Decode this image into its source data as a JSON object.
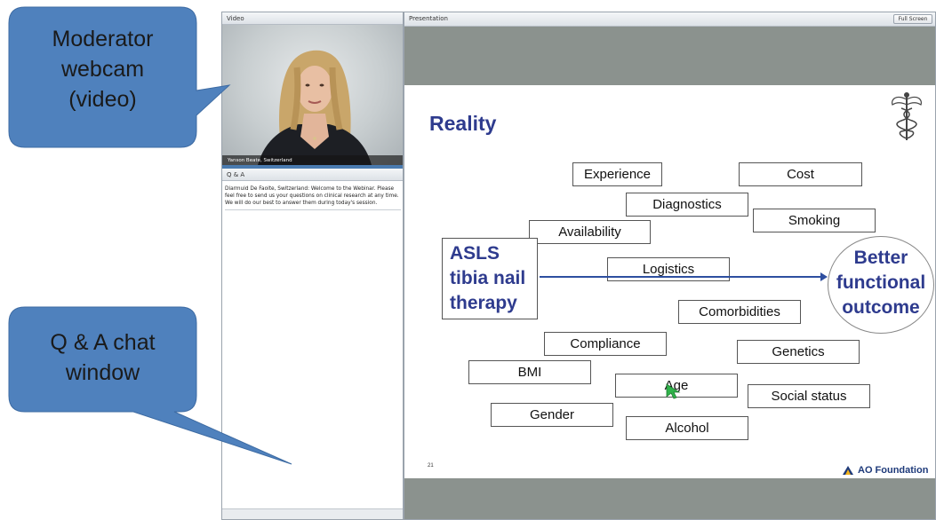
{
  "video_panel": {
    "header": "Video",
    "caption": "Yanson Beate, Switzerland"
  },
  "qa_panel": {
    "header": "Q & A",
    "message": "Diarmuid De Faoite, Switzerland: Welcome to the Webinar. Please feel free to send us your questions on clinical research at any time. We will do our best to answer them during today's session."
  },
  "presentation": {
    "header": "Presentation",
    "fullscreen_label": "Full Screen",
    "slide": {
      "title": "Reality",
      "number": "21",
      "logo_text": "AO Foundation",
      "left_term": [
        "ASLS",
        "tibia nail",
        "therapy"
      ],
      "right_term": [
        "Better",
        "functional",
        "outcome"
      ],
      "factors": {
        "experience": "Experience",
        "cost": "Cost",
        "diagnostics": "Diagnostics",
        "smoking": "Smoking",
        "availability": "Availability",
        "logistics": "Logistics",
        "comorbidities": "Comorbidities",
        "compliance": "Compliance",
        "genetics": "Genetics",
        "bmi": "BMI",
        "age": "Age",
        "social_status": "Social status",
        "gender": "Gender",
        "alcohol": "Alcohol"
      }
    }
  },
  "callouts": {
    "webcam": [
      "Moderator",
      "webcam",
      "(video)"
    ],
    "chat": [
      "Q & A chat",
      "window"
    ]
  },
  "colors": {
    "callout_fill": "#4f81bd",
    "slide_accent": "#2e3b8e",
    "cursor_green": "#2fb34a"
  }
}
